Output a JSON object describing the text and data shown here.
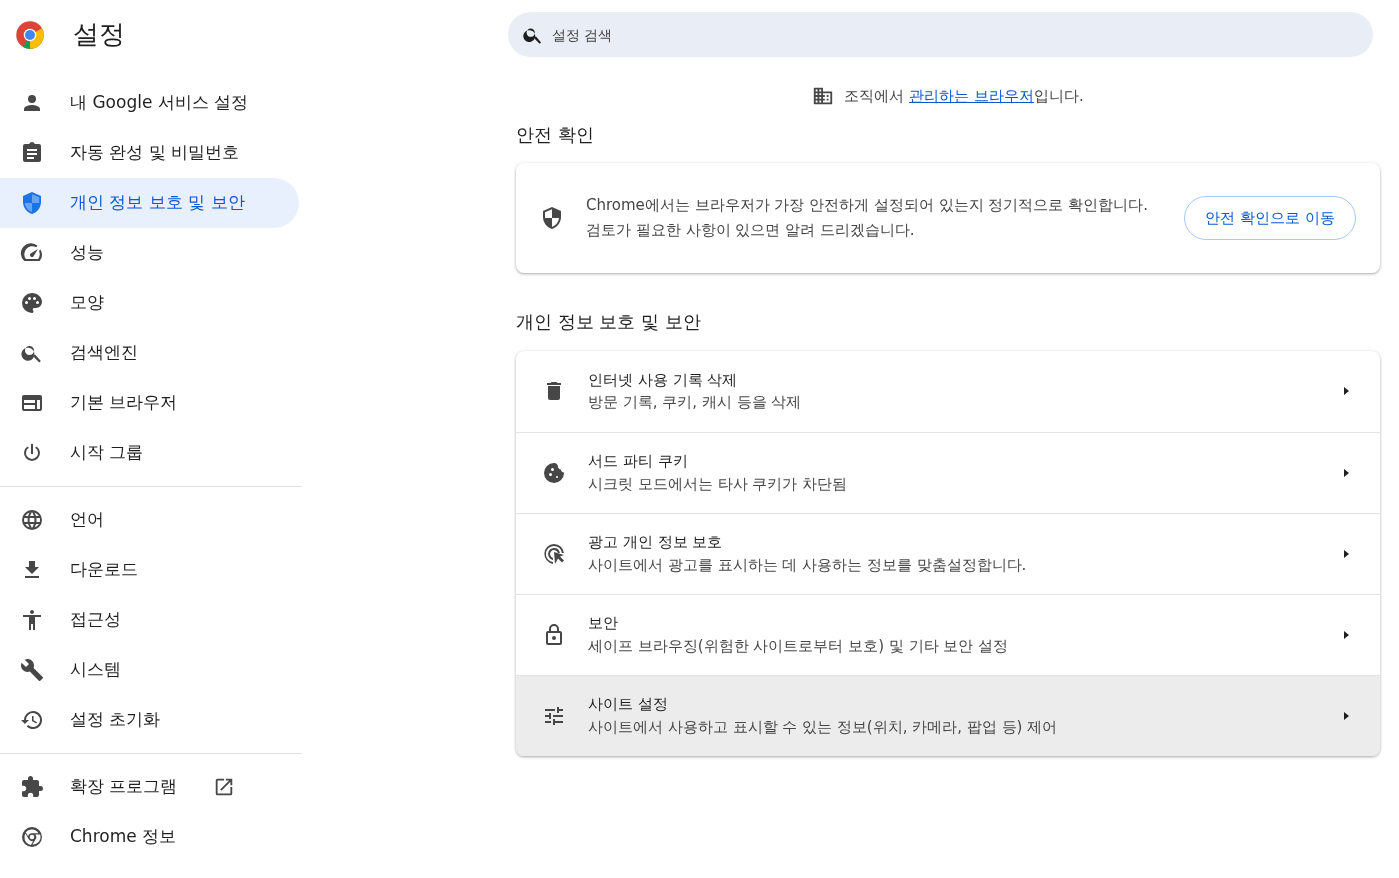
{
  "header": {
    "title": "설정"
  },
  "search": {
    "placeholder": "설정 검색"
  },
  "sidebar": {
    "groups": [
      [
        {
          "label": "내 Google 서비스 설정",
          "selected": false,
          "external": false
        },
        {
          "label": "자동 완성 및 비밀번호",
          "selected": false,
          "external": false
        },
        {
          "label": "개인 정보 보호 및 보안",
          "selected": true,
          "external": false
        },
        {
          "label": "성능",
          "selected": false,
          "external": false
        },
        {
          "label": "모양",
          "selected": false,
          "external": false
        },
        {
          "label": "검색엔진",
          "selected": false,
          "external": false
        },
        {
          "label": "기본 브라우저",
          "selected": false,
          "external": false
        },
        {
          "label": "시작 그룹",
          "selected": false,
          "external": false
        }
      ],
      [
        {
          "label": "언어",
          "selected": false,
          "external": false
        },
        {
          "label": "다운로드",
          "selected": false,
          "external": false
        },
        {
          "label": "접근성",
          "selected": false,
          "external": false
        },
        {
          "label": "시스템",
          "selected": false,
          "external": false
        },
        {
          "label": "설정 초기화",
          "selected": false,
          "external": false
        }
      ],
      [
        {
          "label": "확장 프로그램",
          "selected": false,
          "external": true
        },
        {
          "label": "Chrome 정보",
          "selected": false,
          "external": false
        }
      ]
    ]
  },
  "managed_notice": {
    "prefix": "조직에서 ",
    "link": "관리하는 브라우저",
    "suffix": "입니다."
  },
  "safety_check": {
    "heading": "안전 확인",
    "text": "Chrome에서는 브라우저가 가장 안전하게 설정되어 있는지 정기적으로 확인합니다. 검토가 필요한 사항이 있으면 알려 드리겠습니다.",
    "button": "안전 확인으로 이동"
  },
  "privacy": {
    "heading": "개인 정보 보호 및 보안",
    "rows": [
      {
        "title": "인터넷 사용 기록 삭제",
        "subtitle": "방문 기록, 쿠키, 캐시 등을 삭제",
        "hovered": false
      },
      {
        "title": "서드 파티 쿠키",
        "subtitle": "시크릿 모드에서는 타사 쿠키가 차단됨",
        "hovered": false
      },
      {
        "title": "광고 개인 정보 보호",
        "subtitle": "사이트에서 광고를 표시하는 데 사용하는 정보를 맞춤설정합니다.",
        "hovered": false
      },
      {
        "title": "보안",
        "subtitle": "세이프 브라우징(위험한 사이트로부터 보호) 및 기타 보안 설정",
        "hovered": false
      },
      {
        "title": "사이트 설정",
        "subtitle": "사이트에서 사용하고 표시할 수 있는 정보(위치, 카메라, 팝업 등) 제어",
        "hovered": true
      }
    ]
  }
}
